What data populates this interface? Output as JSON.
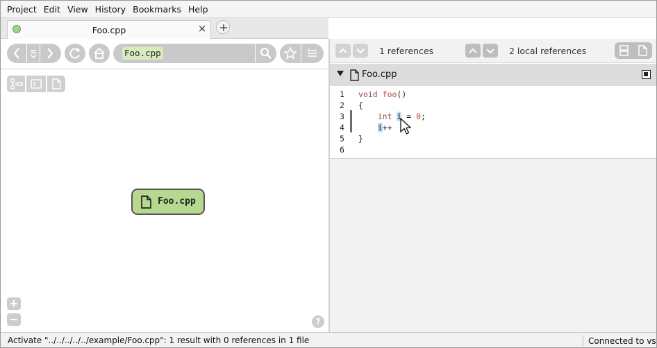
{
  "menu": {
    "items": [
      "Project",
      "Edit",
      "View",
      "History",
      "Bookmarks",
      "Help"
    ]
  },
  "tab": {
    "label": "Foo.cpp",
    "close_glyph": "×",
    "new_glyph": "+"
  },
  "search": {
    "query": "Foo.cpp"
  },
  "graph": {
    "node_label": "Foo.cpp",
    "help_glyph": "?"
  },
  "references": {
    "count_label": "1 references",
    "local_label": "2 local references"
  },
  "code_view": {
    "file_name": "Foo.cpp",
    "lines": [
      {
        "n": "1"
      },
      {
        "n": "2"
      },
      {
        "n": "3"
      },
      {
        "n": "4"
      },
      {
        "n": "5"
      },
      {
        "n": "6"
      }
    ],
    "tokens": {
      "void": "void",
      "foo": "foo",
      "parens": "()",
      "brace_open": "{",
      "int": "int",
      "var": "i",
      "assign": " = ",
      "zero": "0",
      "semicolon": ";",
      "var2": "i",
      "incr": "++",
      "brace_close": "}"
    }
  },
  "status": {
    "message": "Activate \"../../../../../example/Foo.cpp\": 1 result with 0 references in 1 file",
    "connection": "Connected to vs"
  },
  "colors": {
    "node_fill": "#b6d98f",
    "highlight": "#bfe0f7",
    "search_chip": "#d7ebbd"
  }
}
